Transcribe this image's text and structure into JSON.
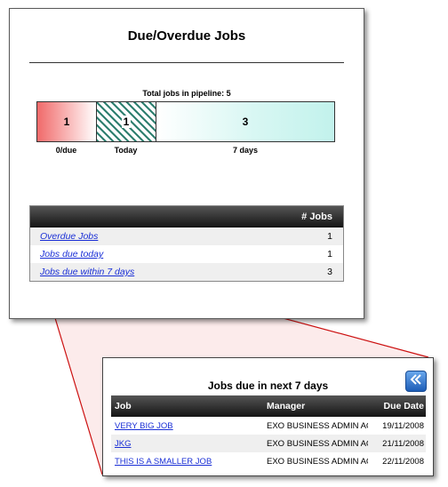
{
  "main": {
    "title": "Due/Overdue Jobs",
    "pipeline_caption": "Total jobs in pipeline: 5",
    "pipeline": [
      {
        "label": "0/due",
        "count": "1"
      },
      {
        "label": "Today",
        "count": "1"
      },
      {
        "label": "7 days",
        "count": "3"
      }
    ],
    "jobs_table": {
      "header": "# Jobs",
      "rows": [
        {
          "label": "Overdue Jobs",
          "count": "1"
        },
        {
          "label": "Jobs due today",
          "count": "1"
        },
        {
          "label": "Jobs due within 7 days",
          "count": "3"
        }
      ]
    }
  },
  "detail": {
    "title": "Jobs due in next 7 days",
    "back_icon": "double-chevron-left-icon",
    "columns": {
      "job": "Job",
      "manager": "Manager",
      "due_date": "Due Date"
    },
    "rows": [
      {
        "job": "VERY BIG JOB",
        "manager": "EXO BUSINESS ADMIN ACCOUNT",
        "due_date": "19/11/2008"
      },
      {
        "job": "JKG",
        "manager": "EXO BUSINESS ADMIN ACCOUNT",
        "due_date": "21/11/2008"
      },
      {
        "job": "THIS IS A SMALLER JOB",
        "manager": "EXO BUSINESS ADMIN ACCOUNT",
        "due_date": "22/11/2008"
      }
    ]
  },
  "colors": {
    "overdue": "#f06a6a",
    "today_hatch": "#2e7f6f",
    "week": "#c2f2ec",
    "link": "#1a2fd6",
    "callout": "#cc1111",
    "header_bg": "#141414"
  }
}
